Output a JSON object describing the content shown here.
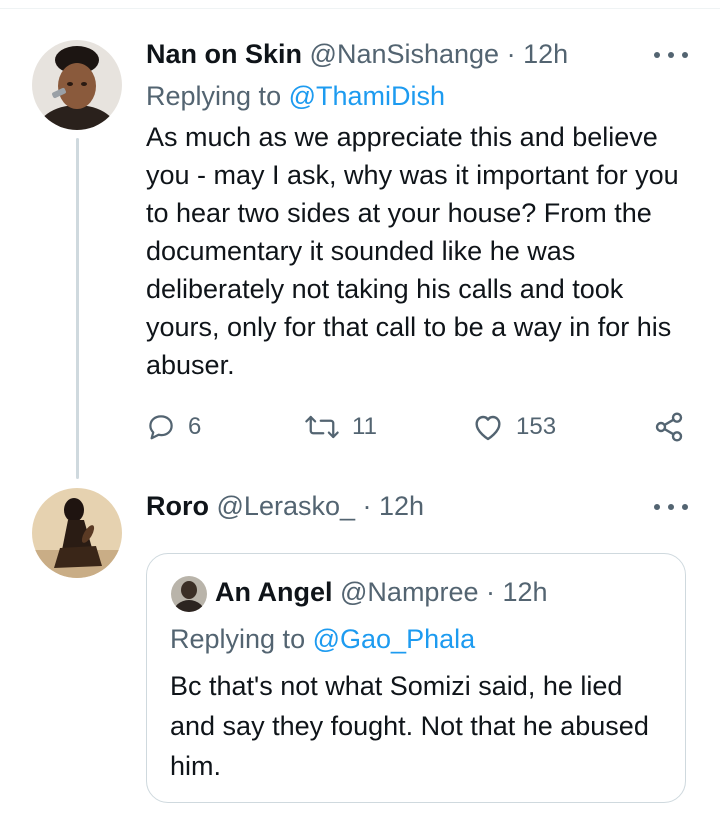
{
  "tweet1": {
    "display_name": "Nan on Skin",
    "handle": "@NanSishange",
    "time": "· 12h",
    "replying_prefix": "Replying to",
    "replying_to": "@ThamiDish",
    "text": "As much as we appreciate this and believe you - may I ask, why was it important for you to hear two sides at your house? From the documentary it sounded like he was deliberately not taking his calls and took yours, only for that call to be a way in for his abuser.",
    "replies": "6",
    "retweets": "11",
    "likes": "153"
  },
  "tweet2": {
    "display_name": "Roro",
    "handle": "@Lerasko_",
    "time": "· 12h",
    "quote": {
      "display_name": "An Angel",
      "handle": "@Nampree",
      "time": "· 12h",
      "replying_prefix": "Replying to",
      "replying_to": "@Gao_Phala",
      "text": "Bc that's not what Somizi said, he lied and say they fought. Not that he abused him."
    }
  },
  "colors": {
    "text": "#0f1419",
    "muted": "#536471",
    "link": "#1d9bf0",
    "border": "#cfd9de"
  }
}
